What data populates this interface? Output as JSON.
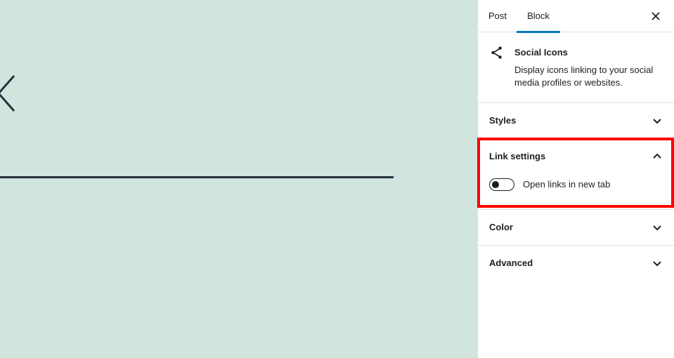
{
  "colors": {
    "canvas_background": "#d1e4dd",
    "canvas_ink": "#28303d",
    "accent": "#007cba",
    "highlight": "#ff0000",
    "toggle_knob": "#1e1e1e"
  },
  "sidebar": {
    "tabs": [
      {
        "label": "Post",
        "active": false
      },
      {
        "label": "Block",
        "active": true
      }
    ],
    "close_icon": "close-icon"
  },
  "block_card": {
    "icon": "share-icon",
    "title": "Social Icons",
    "description": "Display icons linking to your social media profiles or websites."
  },
  "panels": {
    "styles": {
      "title": "Styles",
      "expanded": false
    },
    "link_settings": {
      "title": "Link settings",
      "expanded": true,
      "toggle_label": "Open links in new tab",
      "toggle_checked": false
    },
    "color": {
      "title": "Color",
      "expanded": false
    },
    "advanced": {
      "title": "Advanced",
      "expanded": false
    }
  }
}
